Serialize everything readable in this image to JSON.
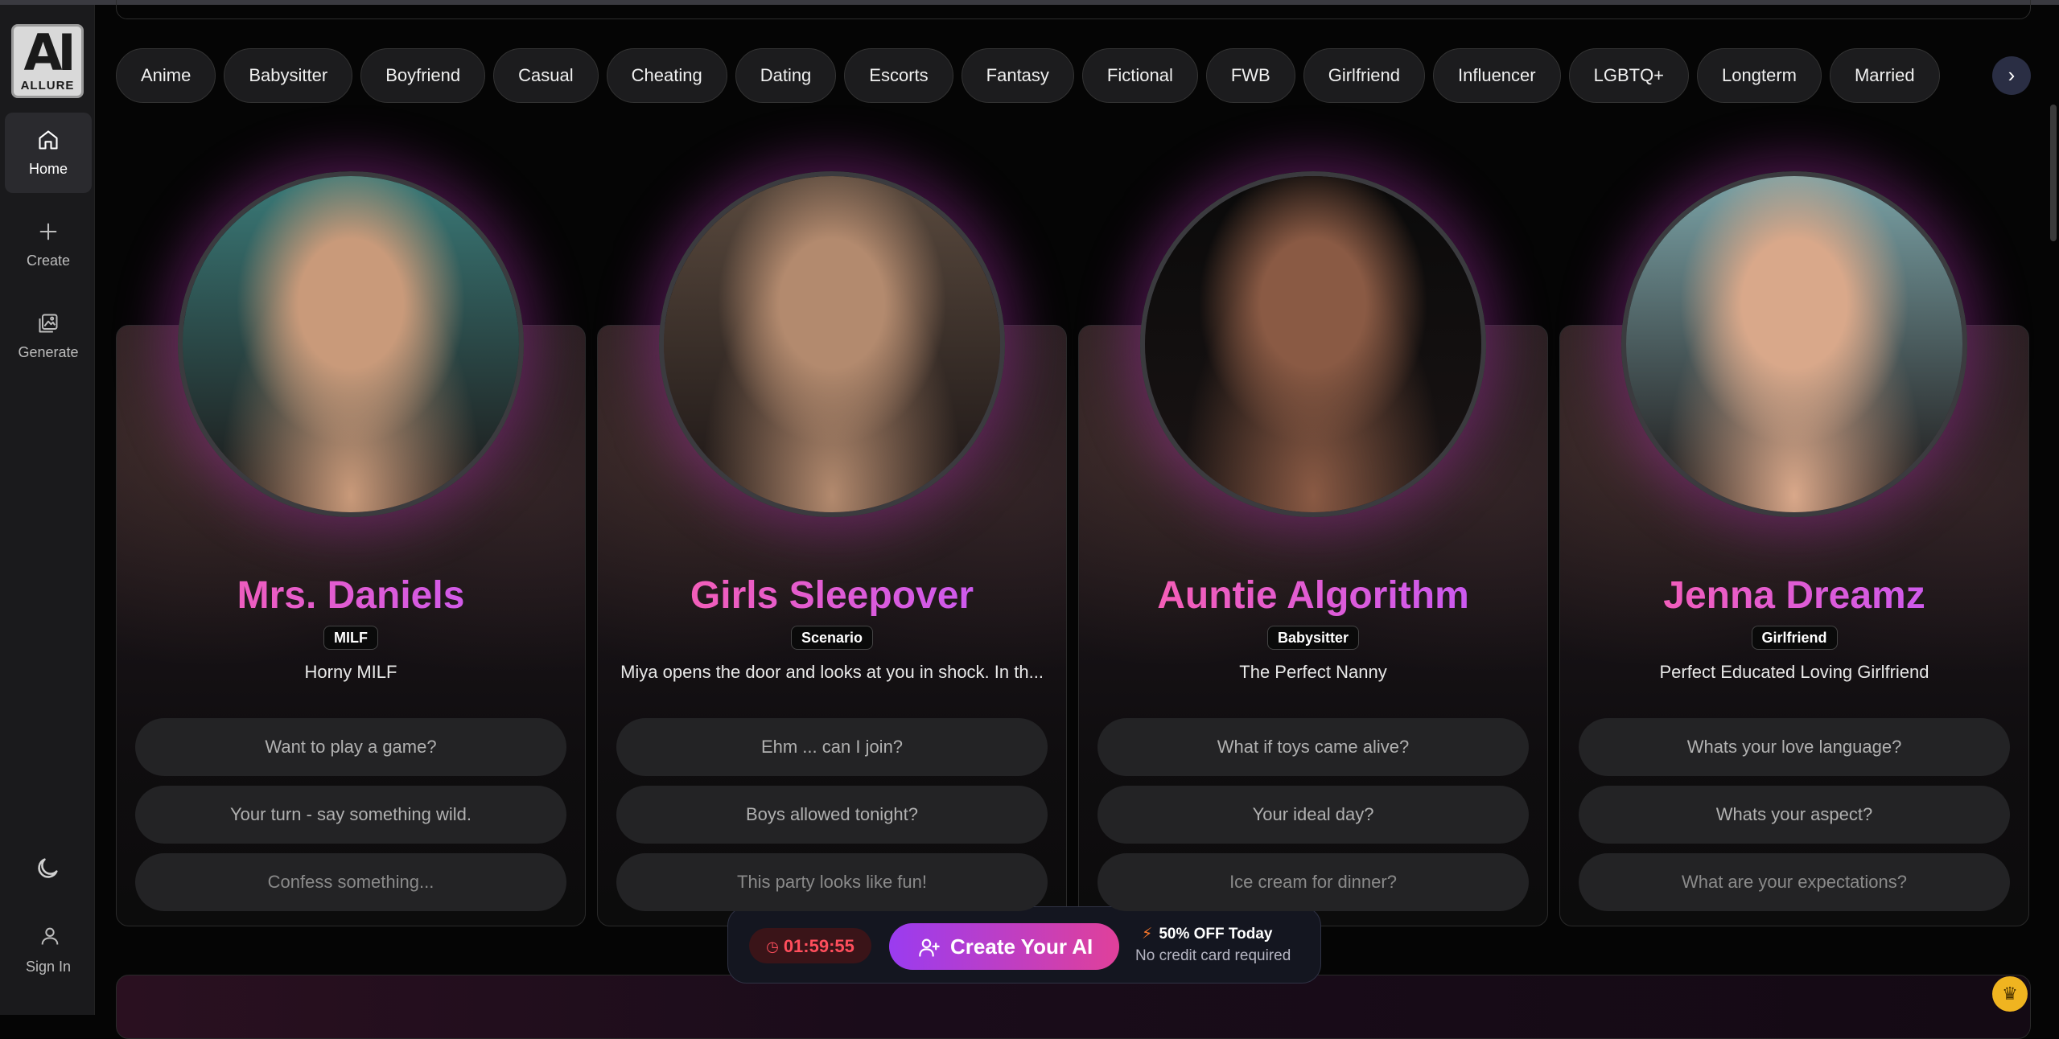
{
  "sidebar": {
    "logo": {
      "top": "AI",
      "bottom": "ALLURE"
    },
    "items": [
      {
        "label": "Home",
        "icon": "home-icon",
        "active": true
      },
      {
        "label": "Create",
        "icon": "plus-icon",
        "active": false
      },
      {
        "label": "Generate",
        "icon": "image-icon",
        "active": false
      }
    ],
    "theme_icon": "moon-icon",
    "signin_label": "Sign In"
  },
  "categories": [
    "Anime",
    "Babysitter",
    "Boyfriend",
    "Casual",
    "Cheating",
    "Dating",
    "Escorts",
    "Fantasy",
    "Fictional",
    "FWB",
    "Girlfriend",
    "Influencer",
    "LGBTQ+",
    "Longterm",
    "Married"
  ],
  "cards": [
    {
      "name": "Mrs. Daniels",
      "tag": "MILF",
      "tagline": "Horny MILF",
      "prompts": [
        "Want to play a game?",
        "Your turn - say something wild.",
        "Confess something..."
      ],
      "avatar_colors": [
        "#c99a7a",
        "#3a7a78"
      ]
    },
    {
      "name": "Girls Sleepover",
      "tag": "Scenario",
      "tagline": "Miya opens the door and looks at you in shock. In th...",
      "prompts": [
        "Ehm ... can I join?",
        "Boys allowed tonight?",
        "This party looks like fun!"
      ],
      "avatar_colors": [
        "#b38a6e",
        "#5a4a3e"
      ]
    },
    {
      "name": "Auntie Algorithm",
      "tag": "Babysitter",
      "tagline": "The Perfect Nanny",
      "prompts": [
        "What if toys came alive?",
        "Your ideal day?",
        "Ice cream for dinner?"
      ],
      "avatar_colors": [
        "#8a5a44",
        "#0a0a0a"
      ]
    },
    {
      "name": "Jenna Dreamz",
      "tag": "Girlfriend",
      "tagline": "Perfect Educated Loving Girlfriend",
      "prompts": [
        "Whats your love language?",
        "Whats your aspect?",
        "What are your expectations?"
      ],
      "avatar_colors": [
        "#d9a88a",
        "#7aa2a6"
      ]
    }
  ],
  "promo": {
    "timer": "01:59:55",
    "button": "Create Your AI",
    "offer_title": "50% OFF Today",
    "offer_sub": "No credit card required"
  }
}
